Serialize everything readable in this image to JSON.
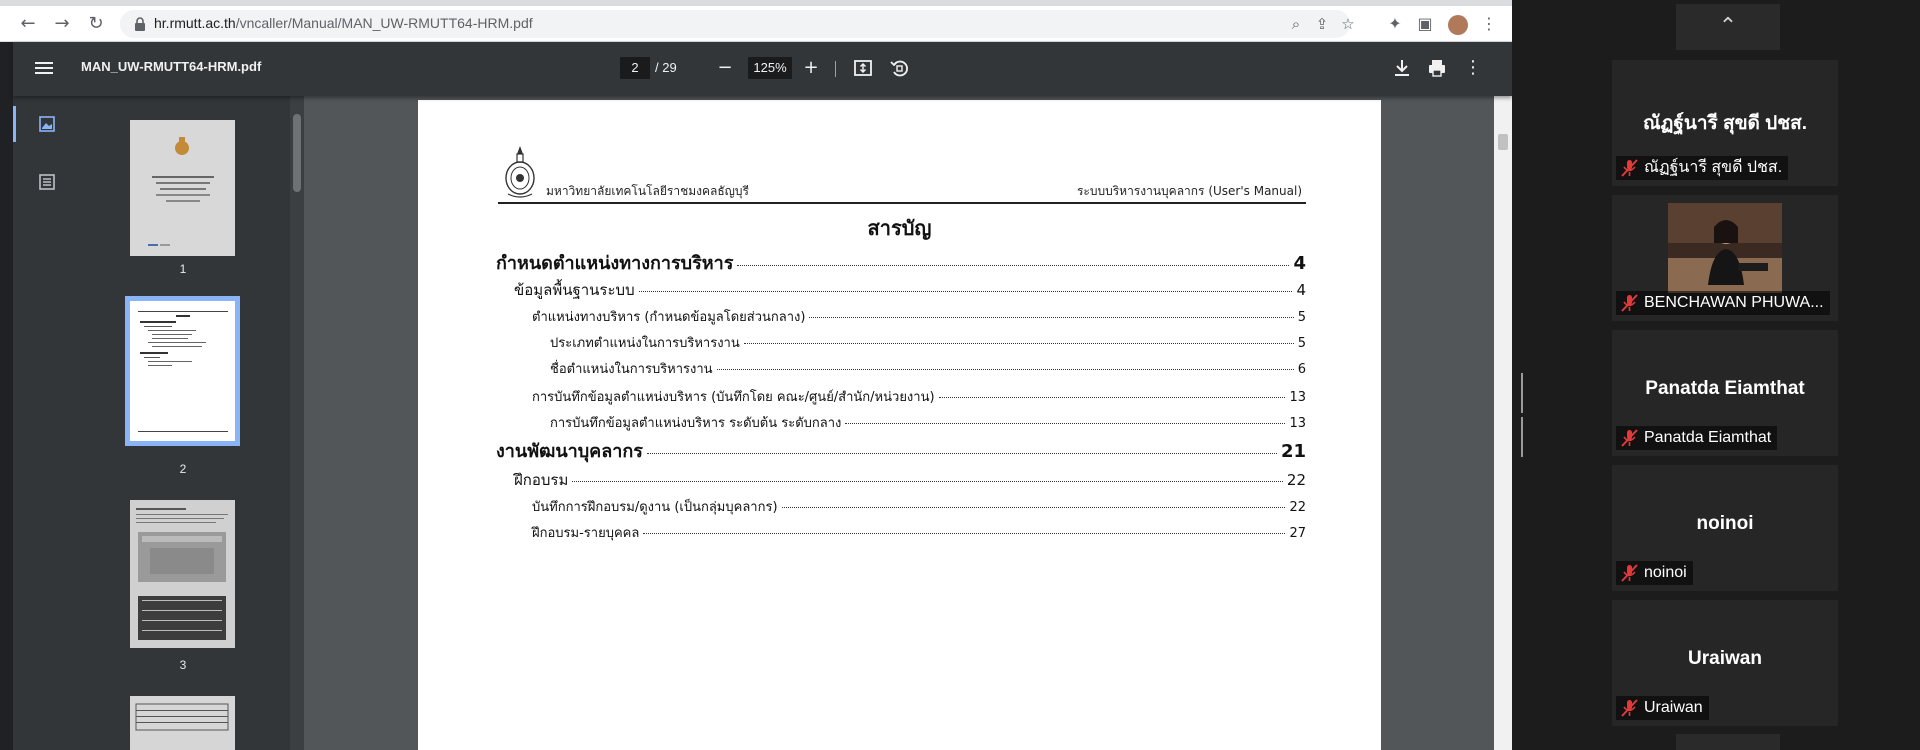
{
  "browser": {
    "url_host": "hr.rmutt.ac.th",
    "url_path": "/vncaller/Manual/MAN_UW-RMUTT64-HRM.pdf"
  },
  "pdf_viewer": {
    "filename": "MAN_UW-RMUTT64-HRM.pdf",
    "current_page": "2",
    "total_pages": "/ 29",
    "zoom": "125%",
    "thumbnails": [
      {
        "label": "1"
      },
      {
        "label": "2"
      },
      {
        "label": "3"
      }
    ]
  },
  "document": {
    "university": "มหาวิทยาลัยเทคโนโลยีราชมงคลธัญบุรี",
    "manual": "ระบบบริหารงานบุคลากร (User's Manual)",
    "toc_title": "สารบัญ",
    "toc": [
      {
        "level": 1,
        "text": "กำหนดตำแหน่งทางการบริหาร",
        "page": "4"
      },
      {
        "level": 2,
        "text": "ข้อมูลพื้นฐานระบบ",
        "page": "4"
      },
      {
        "level": 3,
        "text": "ตำแหน่งทางบริหาร (กำหนดข้อมูลโดยส่วนกลาง)",
        "page": "5"
      },
      {
        "level": 4,
        "text": "ประเภทตำแหน่งในการบริหารงาน",
        "page": "5"
      },
      {
        "level": 4,
        "text": "ชื่อตำแหน่งในการบริหารงาน",
        "page": "6"
      },
      {
        "level": 3,
        "text": "การบันทึกข้อมูลตำแหน่งบริหาร (บันทึกโดย คณะ/ศูนย์/สำนัก/หน่วยงาน)",
        "page": "13"
      },
      {
        "level": 4,
        "text": "การบันทึกข้อมูลตำแหน่งบริหาร ระดับต้น ระดับกลาง",
        "page": "13"
      },
      {
        "level": 1,
        "text": "งานพัฒนาบุคลากร",
        "page": "21"
      },
      {
        "level": 2,
        "text": "ฝึกอบรม",
        "page": "22"
      },
      {
        "level": 3,
        "text": "บันทึกการฝึกอบรม/ดูงาน (เป็นกลุ่มบุคลากร)",
        "page": "22"
      },
      {
        "level": 3,
        "text": "ฝึกอบรม-รายบุคคล",
        "page": "27"
      }
    ]
  },
  "participants": [
    {
      "display_name": "ณัฏฐ์นารี สุขดี ปชส.",
      "footer": "ณัฏฐ์นารี สุขดี ปชส.",
      "video": false
    },
    {
      "display_name": "",
      "footer": "BENCHAWAN PHUWA...",
      "video": true
    },
    {
      "display_name": "Panatda Eiamthat",
      "footer": "Panatda Eiamthat",
      "video": false
    },
    {
      "display_name": "noinoi",
      "footer": "noinoi",
      "video": false
    },
    {
      "display_name": "Uraiwan",
      "footer": "Uraiwan",
      "video": false
    }
  ],
  "colors": {
    "toolbar": "#323639",
    "doc_bg": "#525659",
    "thumb_highlight": "#8ab4f8",
    "mic_muted": "#e03a3a"
  }
}
